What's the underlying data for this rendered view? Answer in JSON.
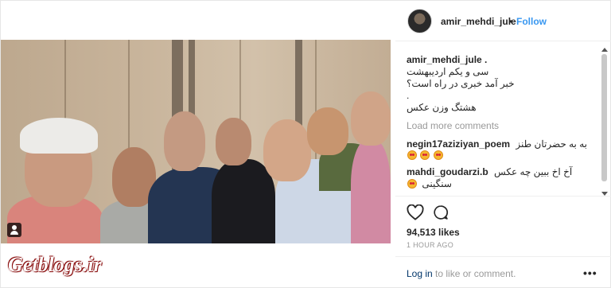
{
  "header": {
    "username": "amir_mehdi_jule",
    "separator": "•",
    "follow_label": "Follow"
  },
  "caption": {
    "username": "amir_mehdi_jule .",
    "lines": [
      "سی و یکم اردیبهشت",
      "خبر آمد خبری در راه است؟",
      ".",
      "هشتگ وزن عکس"
    ]
  },
  "load_more_label": "Load more comments",
  "comments": [
    {
      "username": "negin17aziziyan_poem",
      "text": "به به حضرتان طنز",
      "emoji_count": 3
    },
    {
      "username": "mahdi_goudarzi.b",
      "text": "آخ اخ ببین چه عکس",
      "text2": "سنگینی",
      "emoji_count": 1
    }
  ],
  "icons": {
    "like": "heart-icon",
    "comment": "comment-bubble-icon",
    "options": "more-options-icon",
    "tag": "user-tag-icon"
  },
  "likes": "94,513 likes",
  "timestamp": "1 HOUR AGO",
  "footer": {
    "login_label": "Log in",
    "login_rest": "to like or comment.",
    "more_label": "•••"
  },
  "watermark": "Getblogs.ir",
  "colors": {
    "follow": "#3897f0",
    "link": "#003569",
    "muted": "#999999"
  }
}
